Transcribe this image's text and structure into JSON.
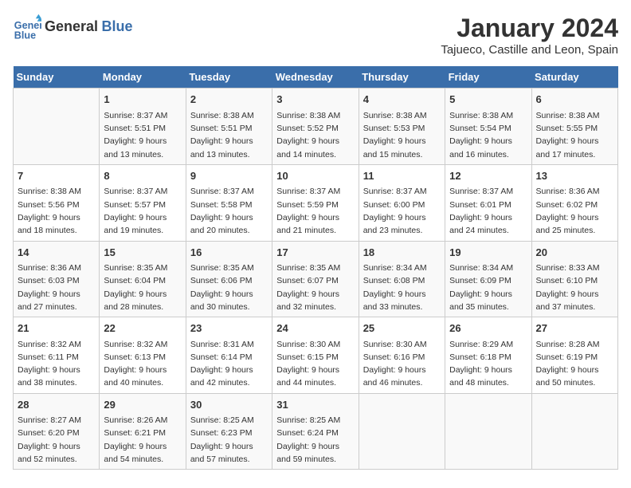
{
  "logo": {
    "line1": "General",
    "line2": "Blue"
  },
  "title": "January 2024",
  "subtitle": "Tajueco, Castille and Leon, Spain",
  "days_header": [
    "Sunday",
    "Monday",
    "Tuesday",
    "Wednesday",
    "Thursday",
    "Friday",
    "Saturday"
  ],
  "weeks": [
    [
      {
        "day": "",
        "sunrise": "",
        "sunset": "",
        "daylight": ""
      },
      {
        "day": "1",
        "sunrise": "Sunrise: 8:37 AM",
        "sunset": "Sunset: 5:51 PM",
        "daylight": "Daylight: 9 hours and 13 minutes."
      },
      {
        "day": "2",
        "sunrise": "Sunrise: 8:38 AM",
        "sunset": "Sunset: 5:51 PM",
        "daylight": "Daylight: 9 hours and 13 minutes."
      },
      {
        "day": "3",
        "sunrise": "Sunrise: 8:38 AM",
        "sunset": "Sunset: 5:52 PM",
        "daylight": "Daylight: 9 hours and 14 minutes."
      },
      {
        "day": "4",
        "sunrise": "Sunrise: 8:38 AM",
        "sunset": "Sunset: 5:53 PM",
        "daylight": "Daylight: 9 hours and 15 minutes."
      },
      {
        "day": "5",
        "sunrise": "Sunrise: 8:38 AM",
        "sunset": "Sunset: 5:54 PM",
        "daylight": "Daylight: 9 hours and 16 minutes."
      },
      {
        "day": "6",
        "sunrise": "Sunrise: 8:38 AM",
        "sunset": "Sunset: 5:55 PM",
        "daylight": "Daylight: 9 hours and 17 minutes."
      }
    ],
    [
      {
        "day": "7",
        "sunrise": "Sunrise: 8:38 AM",
        "sunset": "Sunset: 5:56 PM",
        "daylight": "Daylight: 9 hours and 18 minutes."
      },
      {
        "day": "8",
        "sunrise": "Sunrise: 8:37 AM",
        "sunset": "Sunset: 5:57 PM",
        "daylight": "Daylight: 9 hours and 19 minutes."
      },
      {
        "day": "9",
        "sunrise": "Sunrise: 8:37 AM",
        "sunset": "Sunset: 5:58 PM",
        "daylight": "Daylight: 9 hours and 20 minutes."
      },
      {
        "day": "10",
        "sunrise": "Sunrise: 8:37 AM",
        "sunset": "Sunset: 5:59 PM",
        "daylight": "Daylight: 9 hours and 21 minutes."
      },
      {
        "day": "11",
        "sunrise": "Sunrise: 8:37 AM",
        "sunset": "Sunset: 6:00 PM",
        "daylight": "Daylight: 9 hours and 23 minutes."
      },
      {
        "day": "12",
        "sunrise": "Sunrise: 8:37 AM",
        "sunset": "Sunset: 6:01 PM",
        "daylight": "Daylight: 9 hours and 24 minutes."
      },
      {
        "day": "13",
        "sunrise": "Sunrise: 8:36 AM",
        "sunset": "Sunset: 6:02 PM",
        "daylight": "Daylight: 9 hours and 25 minutes."
      }
    ],
    [
      {
        "day": "14",
        "sunrise": "Sunrise: 8:36 AM",
        "sunset": "Sunset: 6:03 PM",
        "daylight": "Daylight: 9 hours and 27 minutes."
      },
      {
        "day": "15",
        "sunrise": "Sunrise: 8:35 AM",
        "sunset": "Sunset: 6:04 PM",
        "daylight": "Daylight: 9 hours and 28 minutes."
      },
      {
        "day": "16",
        "sunrise": "Sunrise: 8:35 AM",
        "sunset": "Sunset: 6:06 PM",
        "daylight": "Daylight: 9 hours and 30 minutes."
      },
      {
        "day": "17",
        "sunrise": "Sunrise: 8:35 AM",
        "sunset": "Sunset: 6:07 PM",
        "daylight": "Daylight: 9 hours and 32 minutes."
      },
      {
        "day": "18",
        "sunrise": "Sunrise: 8:34 AM",
        "sunset": "Sunset: 6:08 PM",
        "daylight": "Daylight: 9 hours and 33 minutes."
      },
      {
        "day": "19",
        "sunrise": "Sunrise: 8:34 AM",
        "sunset": "Sunset: 6:09 PM",
        "daylight": "Daylight: 9 hours and 35 minutes."
      },
      {
        "day": "20",
        "sunrise": "Sunrise: 8:33 AM",
        "sunset": "Sunset: 6:10 PM",
        "daylight": "Daylight: 9 hours and 37 minutes."
      }
    ],
    [
      {
        "day": "21",
        "sunrise": "Sunrise: 8:32 AM",
        "sunset": "Sunset: 6:11 PM",
        "daylight": "Daylight: 9 hours and 38 minutes."
      },
      {
        "day": "22",
        "sunrise": "Sunrise: 8:32 AM",
        "sunset": "Sunset: 6:13 PM",
        "daylight": "Daylight: 9 hours and 40 minutes."
      },
      {
        "day": "23",
        "sunrise": "Sunrise: 8:31 AM",
        "sunset": "Sunset: 6:14 PM",
        "daylight": "Daylight: 9 hours and 42 minutes."
      },
      {
        "day": "24",
        "sunrise": "Sunrise: 8:30 AM",
        "sunset": "Sunset: 6:15 PM",
        "daylight": "Daylight: 9 hours and 44 minutes."
      },
      {
        "day": "25",
        "sunrise": "Sunrise: 8:30 AM",
        "sunset": "Sunset: 6:16 PM",
        "daylight": "Daylight: 9 hours and 46 minutes."
      },
      {
        "day": "26",
        "sunrise": "Sunrise: 8:29 AM",
        "sunset": "Sunset: 6:18 PM",
        "daylight": "Daylight: 9 hours and 48 minutes."
      },
      {
        "day": "27",
        "sunrise": "Sunrise: 8:28 AM",
        "sunset": "Sunset: 6:19 PM",
        "daylight": "Daylight: 9 hours and 50 minutes."
      }
    ],
    [
      {
        "day": "28",
        "sunrise": "Sunrise: 8:27 AM",
        "sunset": "Sunset: 6:20 PM",
        "daylight": "Daylight: 9 hours and 52 minutes."
      },
      {
        "day": "29",
        "sunrise": "Sunrise: 8:26 AM",
        "sunset": "Sunset: 6:21 PM",
        "daylight": "Daylight: 9 hours and 54 minutes."
      },
      {
        "day": "30",
        "sunrise": "Sunrise: 8:25 AM",
        "sunset": "Sunset: 6:23 PM",
        "daylight": "Daylight: 9 hours and 57 minutes."
      },
      {
        "day": "31",
        "sunrise": "Sunrise: 8:25 AM",
        "sunset": "Sunset: 6:24 PM",
        "daylight": "Daylight: 9 hours and 59 minutes."
      },
      {
        "day": "",
        "sunrise": "",
        "sunset": "",
        "daylight": ""
      },
      {
        "day": "",
        "sunrise": "",
        "sunset": "",
        "daylight": ""
      },
      {
        "day": "",
        "sunrise": "",
        "sunset": "",
        "daylight": ""
      }
    ]
  ]
}
